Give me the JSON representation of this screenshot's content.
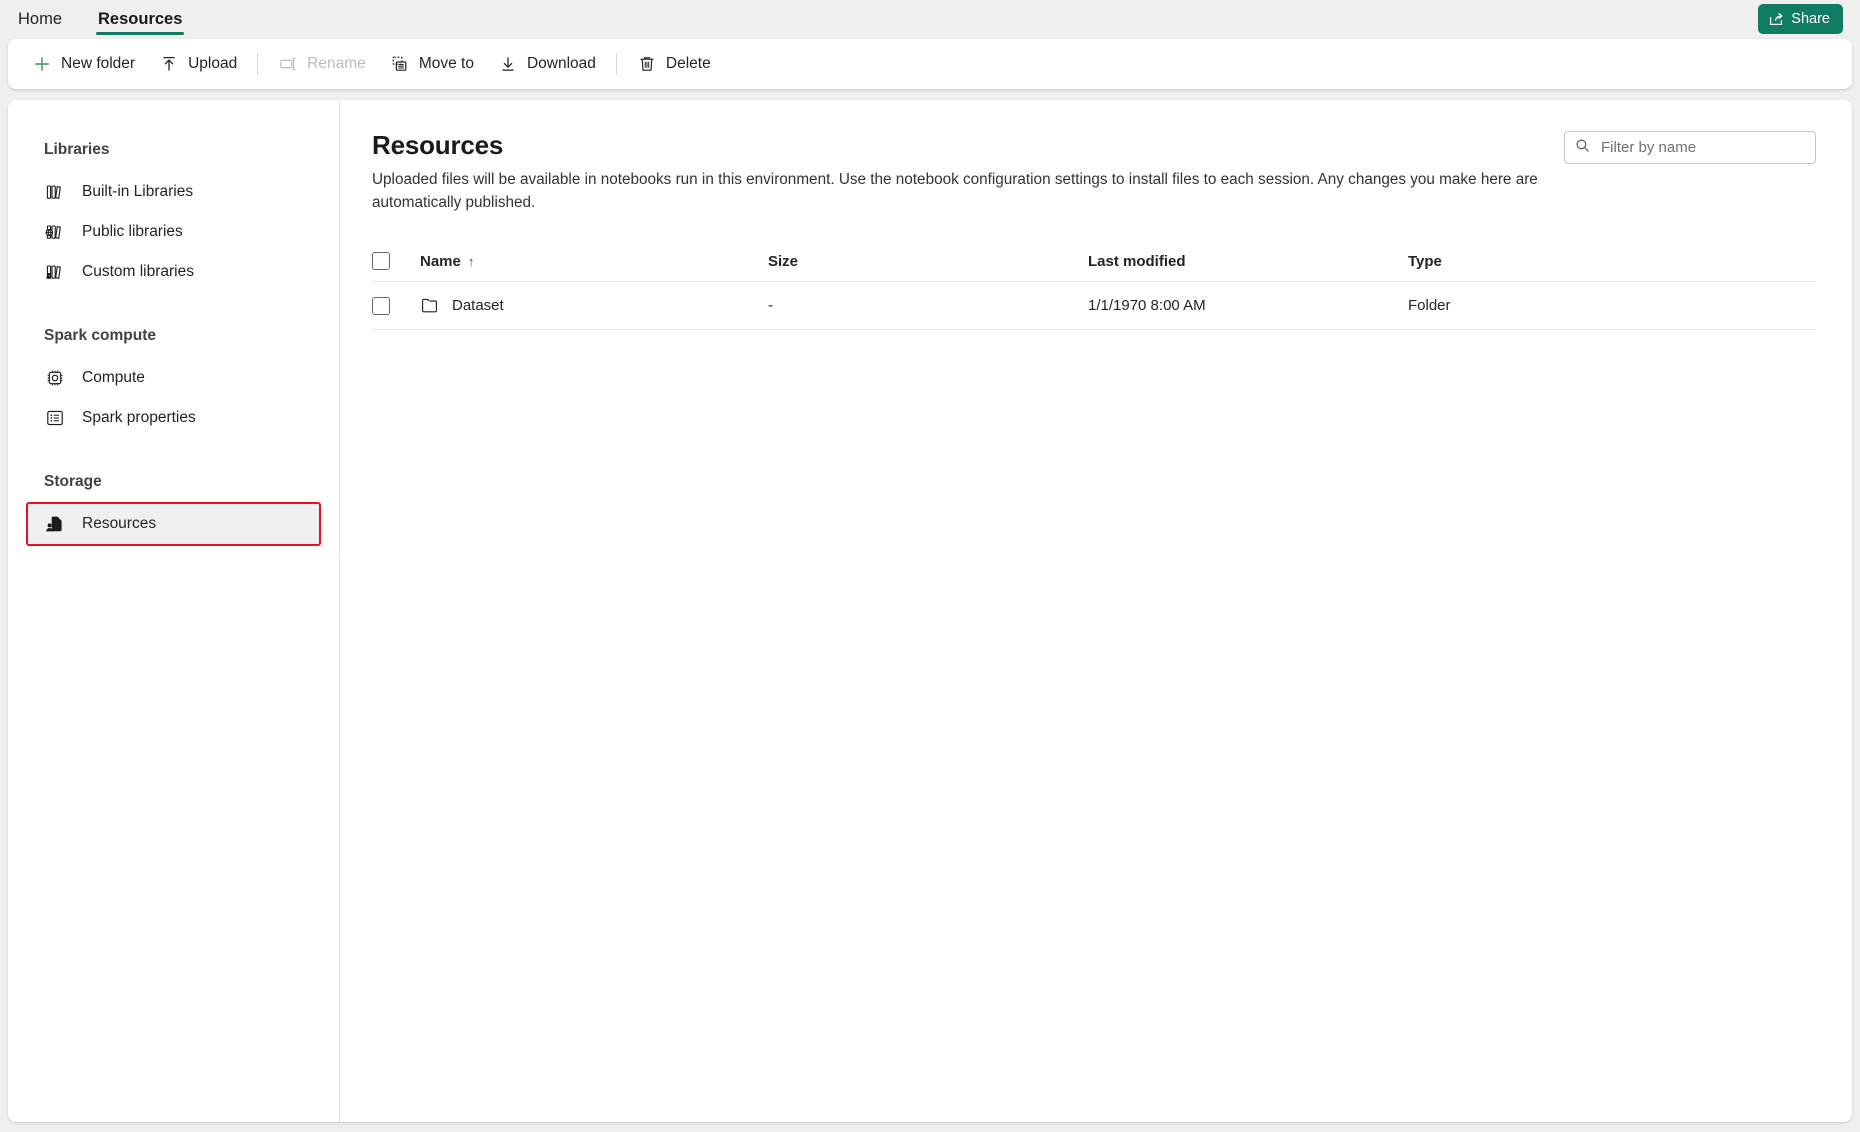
{
  "window": {
    "tabs": [
      {
        "label": "Home",
        "active": false
      },
      {
        "label": "Resources",
        "active": true
      }
    ],
    "share_label": "Share",
    "accent_color": "#107c62",
    "highlight_color": "#e81123"
  },
  "toolbar": {
    "items": [
      {
        "label": "New folder",
        "icon": "plus-icon",
        "disabled": false
      },
      {
        "label": "Upload",
        "icon": "upload-arrow-icon",
        "disabled": false
      },
      {
        "label": "Rename",
        "icon": "rename-icon",
        "disabled": true
      },
      {
        "label": "Move to",
        "icon": "move-to-icon",
        "disabled": false
      },
      {
        "label": "Download",
        "icon": "download-arrow-icon",
        "disabled": false
      },
      {
        "label": "Delete",
        "icon": "trash-icon",
        "disabled": false
      }
    ]
  },
  "sidebar": {
    "groups": [
      {
        "title": "Libraries",
        "items": [
          {
            "label": "Built-in Libraries",
            "icon": "books-icon",
            "highlighted": false
          },
          {
            "label": "Public libraries",
            "icon": "books-globe-icon",
            "highlighted": false
          },
          {
            "label": "Custom libraries",
            "icon": "books-person-icon",
            "highlighted": false
          }
        ]
      },
      {
        "title": "Spark compute",
        "items": [
          {
            "label": "Compute",
            "icon": "chip-gear-icon",
            "highlighted": false
          },
          {
            "label": "Spark properties",
            "icon": "list-box-icon",
            "highlighted": false
          }
        ]
      },
      {
        "title": "Storage",
        "items": [
          {
            "label": "Resources",
            "icon": "document-person-icon",
            "highlighted": true
          }
        ]
      }
    ]
  },
  "main": {
    "title": "Resources",
    "description": "Uploaded files will be available in notebooks run in this environment. Use the notebook configuration settings to install files to each session. Any changes you make here are automatically published.",
    "filter": {
      "placeholder": "Filter by name",
      "value": "",
      "icon": "search-icon"
    },
    "table": {
      "columns": [
        {
          "key": "name",
          "label": "Name",
          "sorted": true,
          "sort_indicator": "↑"
        },
        {
          "key": "size",
          "label": "Size",
          "sorted": false
        },
        {
          "key": "modified",
          "label": "Last modified",
          "sorted": false
        },
        {
          "key": "type",
          "label": "Type",
          "sorted": false
        }
      ],
      "rows": [
        {
          "name": "Dataset",
          "icon": "folder-icon",
          "size": "-",
          "modified": "1/1/1970 8:00 AM",
          "type": "Folder",
          "selected": false
        }
      ]
    }
  }
}
